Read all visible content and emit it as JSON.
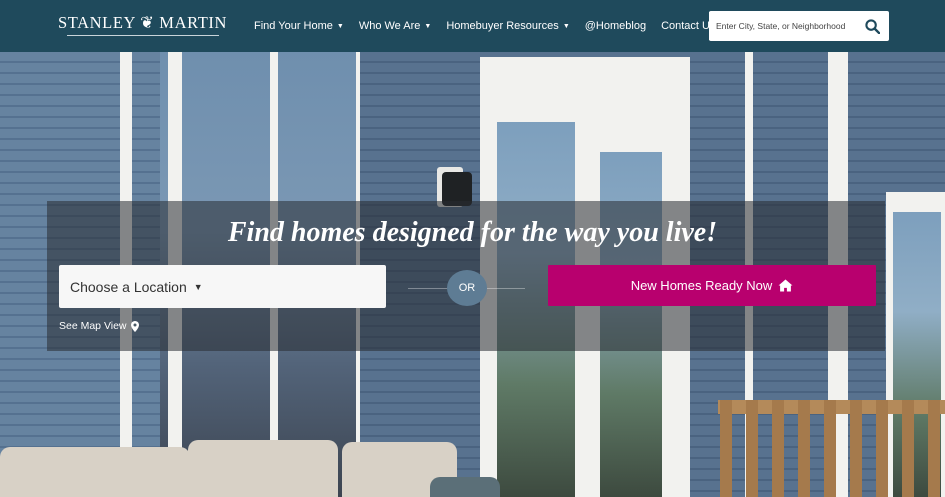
{
  "header": {
    "logo_text": "STANLEY ❦ MARTIN",
    "nav": [
      {
        "label": "Find Your Home",
        "dropdown": true
      },
      {
        "label": "Who We Are",
        "dropdown": true
      },
      {
        "label": "Homebuyer Resources",
        "dropdown": true
      },
      {
        "label": "@Homeblog",
        "dropdown": false
      },
      {
        "label": "Contact Us",
        "dropdown": false
      }
    ],
    "search_placeholder": "Enter City, State, or Neighborhood",
    "search_icon": "search-icon"
  },
  "hero": {
    "tagline": "Find homes designed for the way you live!",
    "location_select_label": "Choose a Location",
    "map_link_label": "See Map View",
    "or_label": "OR",
    "ready_button_label": "New Homes Ready Now",
    "ready_button_icon": "home-icon"
  },
  "colors": {
    "header_bg": "#1f4a5c",
    "accent": "#b8006e",
    "or_circle": "#5e7c94"
  }
}
